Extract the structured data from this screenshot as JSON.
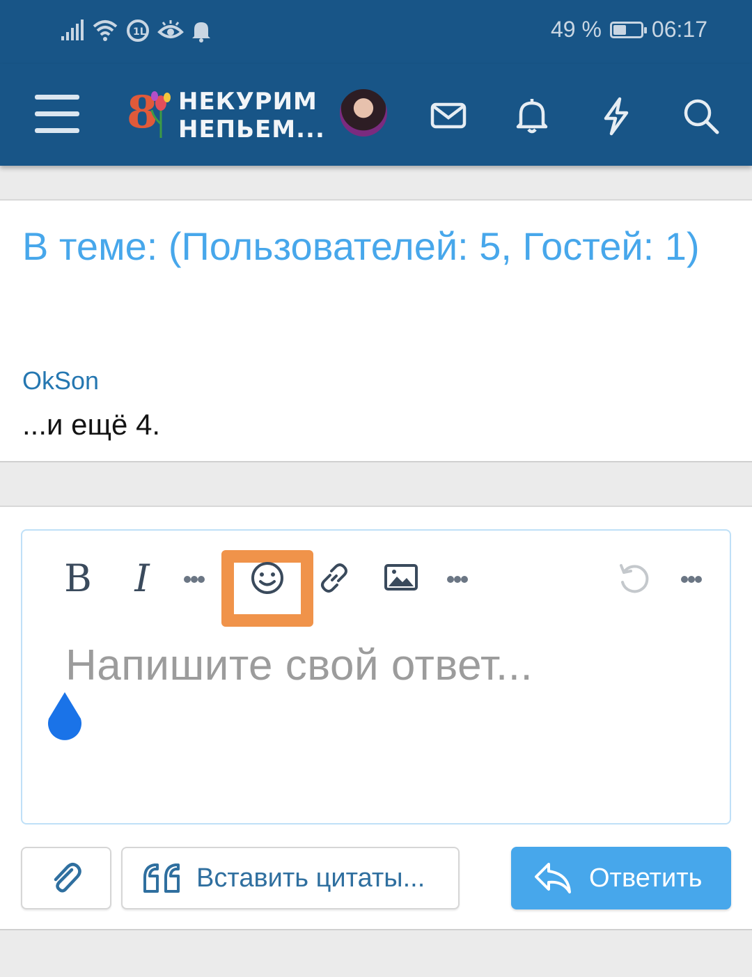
{
  "status_bar": {
    "battery_text": "49 %",
    "battery_level": 0.49,
    "time": "06:17",
    "icons": [
      "signal-icon",
      "wifi-icon",
      "data-saver-icon",
      "eye-icon",
      "notification-bell-icon"
    ]
  },
  "header": {
    "logo_mark": "8",
    "logo_line1": "НЕКУРИМ",
    "logo_line2": "НЕПЬЕМ...",
    "icons": [
      "menu-icon",
      "mail-icon",
      "bell-icon",
      "lightning-icon",
      "search-icon"
    ],
    "color": "#185587"
  },
  "members": {
    "title": "В теме: (Пользователей: 5, Гостей: 1)",
    "user": "OkSon",
    "more": "...и ещё 4."
  },
  "editor": {
    "toolbar": {
      "bold": "B",
      "italic": "I"
    },
    "placeholder": "Напишите свой ответ..."
  },
  "buttons": {
    "quote_label": "Вставить цитаты...",
    "reply_label": "Ответить"
  },
  "colors": {
    "accent": "#47a7eb",
    "highlight": "#f0934a",
    "link": "#2577b1"
  }
}
